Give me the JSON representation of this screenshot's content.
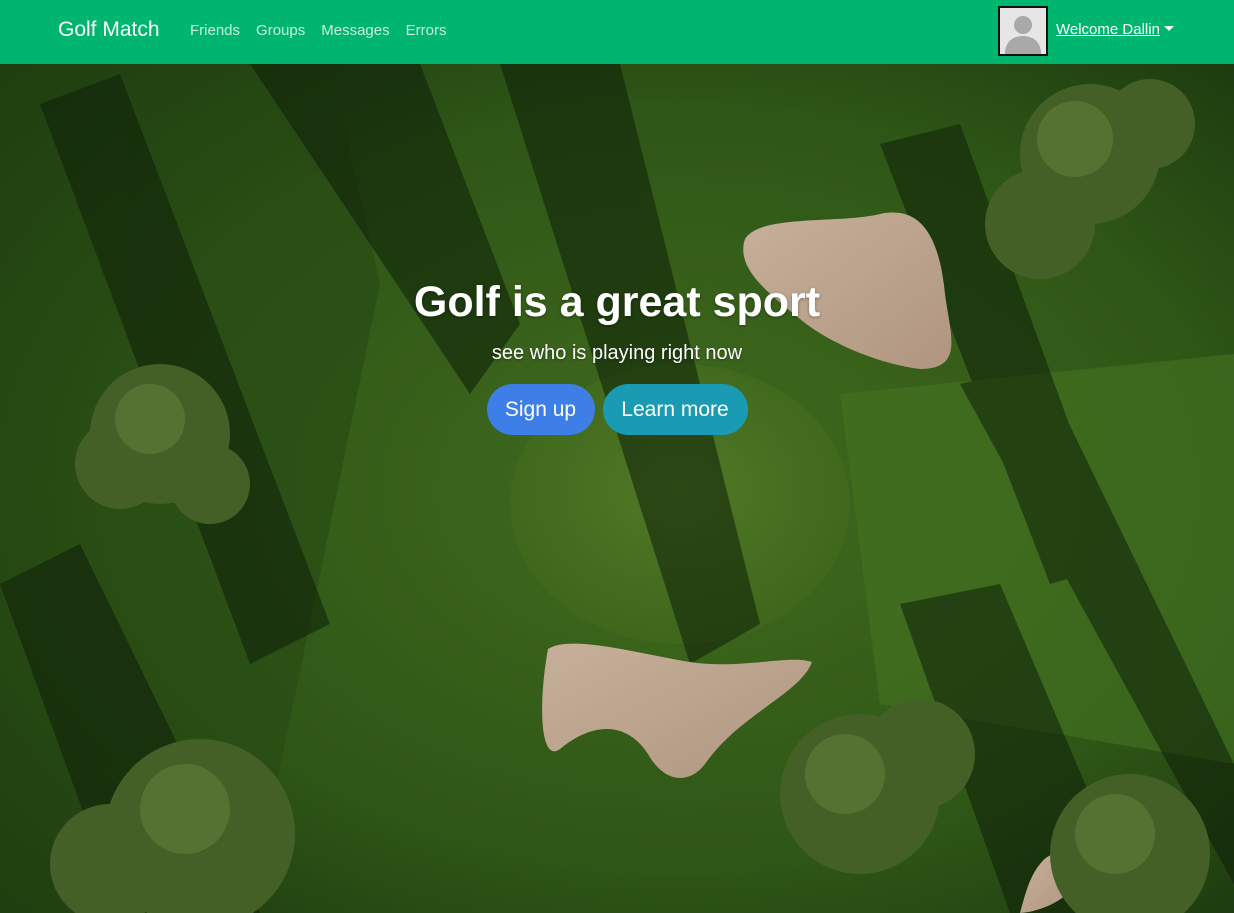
{
  "navbar": {
    "brand": "Golf Match",
    "links": [
      {
        "label": "Friends"
      },
      {
        "label": "Groups"
      },
      {
        "label": "Messages"
      },
      {
        "label": "Errors"
      }
    ],
    "user": {
      "welcome_label": "Welcome Dallin",
      "avatar_icon": "user-avatar-icon",
      "dropdown_icon": "caret-down-icon"
    }
  },
  "hero": {
    "title": "Golf is a great sport",
    "subtitle": "see who is playing right now",
    "signup_label": "Sign up",
    "learn_more_label": "Learn more",
    "background": "aerial-golf-course-photo"
  },
  "colors": {
    "navbar_bg": "#00b66f",
    "signup_button": "#3d7fe6",
    "learn_more_button": "#1a9bb3"
  }
}
